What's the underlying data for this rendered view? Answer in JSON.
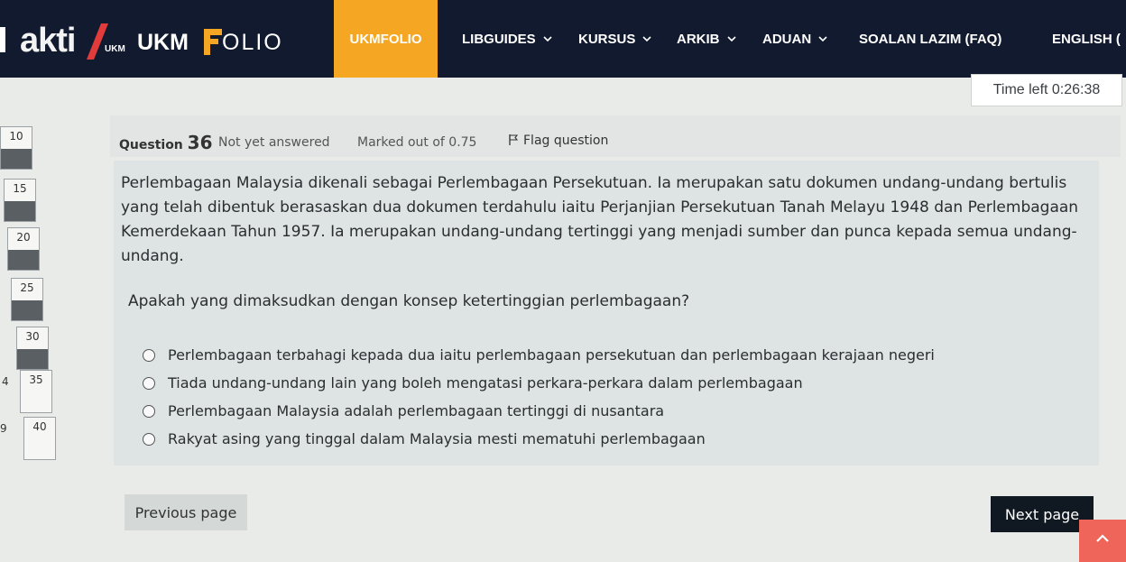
{
  "navbar": {
    "brand": {
      "akti": "akti",
      "ukm_small": "UKM",
      "ukm": "UKM",
      "folio": "OLIO"
    },
    "items": [
      {
        "label": "UKMFOLIO",
        "active": true,
        "has_dropdown": false
      },
      {
        "label": "LIBGUIDES",
        "active": false,
        "has_dropdown": true
      },
      {
        "label": "KURSUS",
        "active": false,
        "has_dropdown": true
      },
      {
        "label": "ARKIB",
        "active": false,
        "has_dropdown": true
      },
      {
        "label": "ADUAN",
        "active": false,
        "has_dropdown": true
      },
      {
        "label": "SOALAN LAZIM (FAQ)",
        "active": false,
        "has_dropdown": false
      },
      {
        "label": "ENGLISH (",
        "active": false,
        "has_dropdown": false
      }
    ],
    "dropdown_icon": "chevron-down-icon",
    "colors": {
      "background": "#111a2e",
      "active": "#f5a623"
    }
  },
  "timer": {
    "label": "Time left",
    "value": "0:26:38"
  },
  "question_nav": {
    "buttons": [
      "10",
      "15",
      "20",
      "25",
      "30",
      "35",
      "40"
    ],
    "side_numbers": [
      "4",
      "9"
    ]
  },
  "question": {
    "label": "Question",
    "number": "36",
    "state": "Not yet answered",
    "marks": "Marked out of 0.75",
    "flag_label": "Flag question",
    "flag_icon": "flag-icon",
    "text": "Perlembagaan Malaysia dikenali sebagai Perlembagaan Persekutuan. Ia merupakan satu dokumen undang-undang bertulis yang telah dibentuk berasaskan dua dokumen terdahulu iaitu Perjanjian Persekutuan Tanah Melayu 1948 dan Perlembagaan Kemerdekaan Tahun 1957. Ia merupakan undang-undang tertinggi yang menjadi sumber dan punca kepada semua undang-undang.",
    "prompt": "Apakah yang dimaksudkan dengan konsep ketertinggian perlembagaan?",
    "answers": [
      "Perlembagaan terbahagi kepada dua iaitu perlembagaan persekutuan dan perlembagaan kerajaan negeri",
      "Tiada undang-undang lain yang boleh mengatasi perkara-perkara dalam perlembagaan",
      "Perlembagaan Malaysia adalah perlembagaan tertinggi di nusantara",
      "Rakyat asing yang tinggal dalam Malaysia mesti mematuhi perlembagaan"
    ]
  },
  "footer": {
    "previous": "Previous page",
    "next": "Next page",
    "scroll_top_icon": "chevron-up-icon",
    "scroll_top_color": "#f0655a"
  }
}
